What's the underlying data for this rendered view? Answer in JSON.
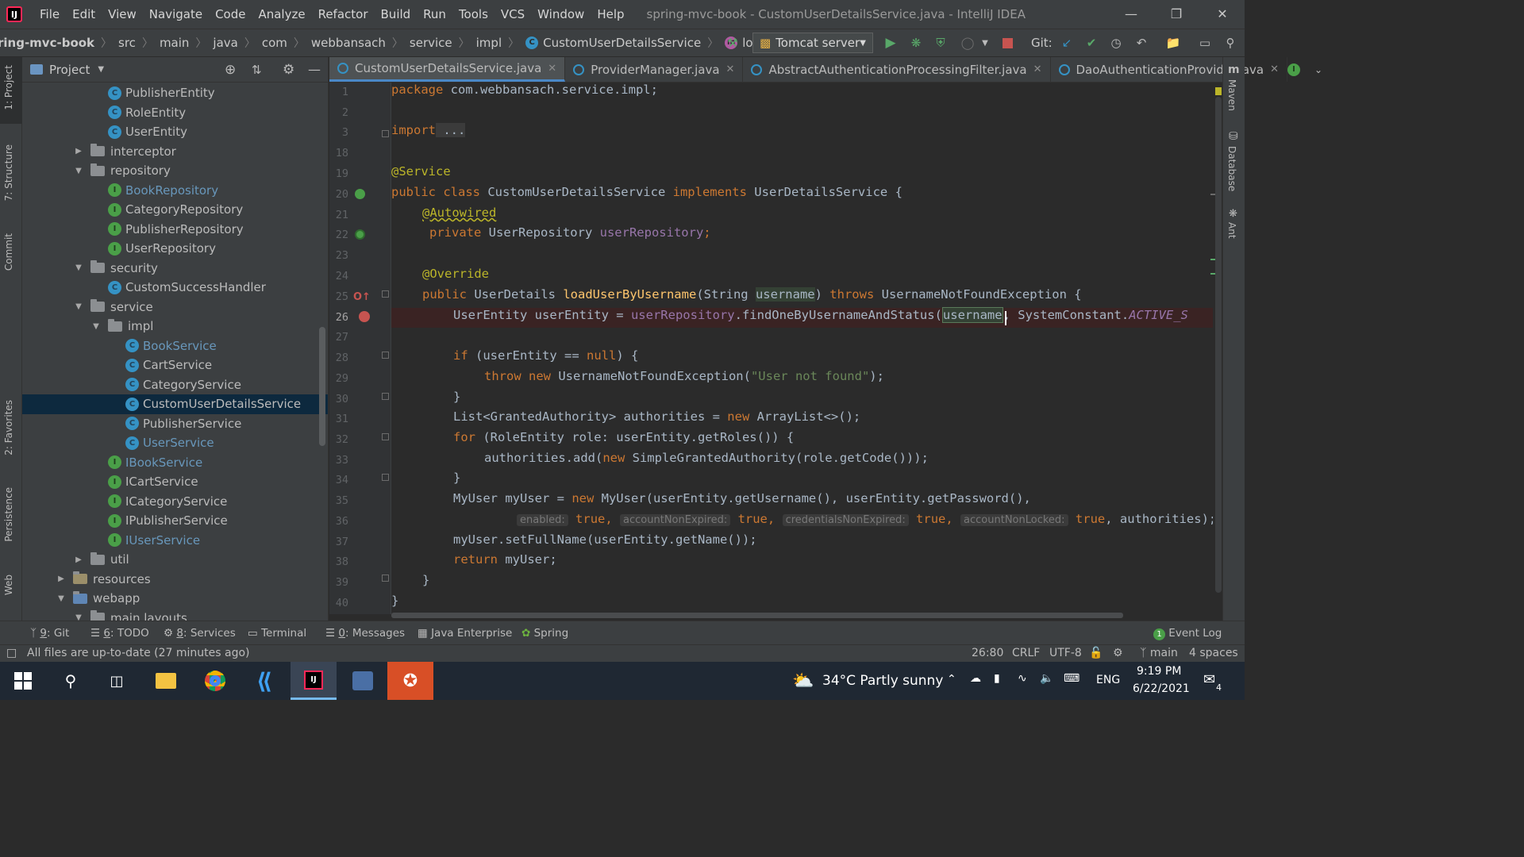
{
  "titlebar": {
    "menu": [
      "File",
      "Edit",
      "View",
      "Navigate",
      "Code",
      "Analyze",
      "Refactor",
      "Build",
      "Run",
      "Tools",
      "VCS",
      "Window",
      "Help"
    ],
    "window_title": "spring-mvc-book - CustomUserDetailsService.java - IntelliJ IDEA"
  },
  "navbar": {
    "crumbs": [
      "ring-mvc-book",
      "src",
      "main",
      "java",
      "com",
      "webbansach",
      "service",
      "impl",
      "CustomUserDetailsService",
      "loadUserByUsername"
    ],
    "run_config": "Tomcat server",
    "git_label": "Git:"
  },
  "left_strip": {
    "tabs": [
      "1: Project",
      "7: Structure",
      "Commit",
      "2: Favorites",
      "Persistence",
      "Web"
    ]
  },
  "right_strip": {
    "tabs": [
      "Maven",
      "Database",
      "Ant"
    ]
  },
  "project": {
    "title": "Project",
    "tree": [
      {
        "label": "PublisherEntity",
        "type": "class",
        "indent": 3,
        "color": "normal"
      },
      {
        "label": "RoleEntity",
        "type": "class",
        "indent": 3,
        "color": "normal"
      },
      {
        "label": "UserEntity",
        "type": "class",
        "indent": 3,
        "color": "normal"
      },
      {
        "label": "interceptor",
        "type": "folder",
        "indent": 2,
        "arrow": "right"
      },
      {
        "label": "repository",
        "type": "folder",
        "indent": 2,
        "arrow": "down"
      },
      {
        "label": "BookRepository",
        "type": "interface",
        "indent": 3,
        "color": "blue"
      },
      {
        "label": "CategoryRepository",
        "type": "interface",
        "indent": 3,
        "color": "normal"
      },
      {
        "label": "PublisherRepository",
        "type": "interface",
        "indent": 3,
        "color": "normal"
      },
      {
        "label": "UserRepository",
        "type": "interface",
        "indent": 3,
        "color": "normal"
      },
      {
        "label": "security",
        "type": "folder",
        "indent": 2,
        "arrow": "down"
      },
      {
        "label": "CustomSuccessHandler",
        "type": "class",
        "indent": 3,
        "color": "normal"
      },
      {
        "label": "service",
        "type": "folder",
        "indent": 2,
        "arrow": "down"
      },
      {
        "label": "impl",
        "type": "folder",
        "indent": 3,
        "arrow": "down"
      },
      {
        "label": "BookService",
        "type": "class",
        "indent": 4,
        "color": "blue"
      },
      {
        "label": "CartService",
        "type": "class",
        "indent": 4,
        "color": "normal"
      },
      {
        "label": "CategoryService",
        "type": "class",
        "indent": 4,
        "color": "normal"
      },
      {
        "label": "CustomUserDetailsService",
        "type": "class",
        "indent": 4,
        "color": "normal",
        "selected": true
      },
      {
        "label": "PublisherService",
        "type": "class",
        "indent": 4,
        "color": "normal"
      },
      {
        "label": "UserService",
        "type": "class",
        "indent": 4,
        "color": "blue"
      },
      {
        "label": "IBookService",
        "type": "interface",
        "indent": 3,
        "color": "blue"
      },
      {
        "label": "ICartService",
        "type": "interface",
        "indent": 3,
        "color": "normal"
      },
      {
        "label": "ICategoryService",
        "type": "interface",
        "indent": 3,
        "color": "normal"
      },
      {
        "label": "IPublisherService",
        "type": "interface",
        "indent": 3,
        "color": "normal"
      },
      {
        "label": "IUserService",
        "type": "interface",
        "indent": 3,
        "color": "blue"
      },
      {
        "label": "util",
        "type": "folder",
        "indent": 2,
        "arrow": "right"
      },
      {
        "label": "resources",
        "type": "folder-res",
        "indent": 1,
        "arrow": "right"
      },
      {
        "label": "webapp",
        "type": "folder-web",
        "indent": 1,
        "arrow": "down"
      },
      {
        "label": "main.layouts",
        "type": "folder",
        "indent": 2,
        "arrow": "down"
      }
    ]
  },
  "editor": {
    "tabs": [
      {
        "label": "CustomUserDetailsService.java",
        "active": true
      },
      {
        "label": "ProviderManager.java",
        "active": false
      },
      {
        "label": "AbstractAuthenticationProcessingFilter.java",
        "active": false
      },
      {
        "label": "DaoAuthenticationProvider.java",
        "active": false
      }
    ],
    "line_numbers": [
      "1",
      "2",
      "3",
      "18",
      "19",
      "20",
      "21",
      "22",
      "23",
      "24",
      "25",
      "26",
      "27",
      "28",
      "29",
      "30",
      "31",
      "32",
      "33",
      "34",
      "35",
      "36",
      "37",
      "38",
      "39",
      "40"
    ],
    "current_line": "26",
    "lines": {
      "l1_kw": "package",
      "l1_rest": " com.webbansach.service.impl;",
      "l3_kw": "import",
      "l3_rest": " ...",
      "l19": "@Service",
      "l20_kw1": "public class",
      "l20_a": " CustomUserDetailsService ",
      "l20_kw2": "implements",
      "l20_b": " UserDetailsService {",
      "l21": "@Autowired",
      "l22_kw": "private",
      "l22_a": " UserRepository ",
      "l22_fld": "userRepository",
      "l22_b": ";",
      "l24": "@Override",
      "l25_kw": "public",
      "l25_a": " UserDetails ",
      "l25_fn": "loadUserByUsername",
      "l25_b": "(String ",
      "l25_param": "username",
      "l25_c": ") ",
      "l25_kw2": "throws",
      "l25_d": " UsernameNotFoundException {",
      "l26_a": "UserEntity userEntity = ",
      "l26_fld": "userRepository",
      "l26_b": ".findOneByUsernameAndStatus(",
      "l26_param": "username",
      "l26_c": ", SystemConstant.",
      "l26_const": "ACTIVE_S",
      "l28_kw": "if",
      "l28_a": " (userEntity == ",
      "l28_kw2": "null",
      "l28_b": ") {",
      "l29_kw": "throw new",
      "l29_a": " UsernameNotFoundException(",
      "l29_str": "\"User not found\"",
      "l29_b": ");",
      "l30": "}",
      "l31_a": "List<GrantedAuthority> authorities = ",
      "l31_kw": "new",
      "l31_b": " ArrayList<>();",
      "l32_kw": "for",
      "l32_a": " (RoleEntity role: userEntity.getRoles()) {",
      "l33_a": "authorities.add(",
      "l33_kw": "new",
      "l33_b": " SimpleGrantedAuthority(role.getCode()));",
      "l34": "}",
      "l35_a": "MyUser myUser = ",
      "l35_kw": "new",
      "l35_b": " MyUser(userEntity.getUsername(), userEntity.getPassword(),",
      "l36_h1": "enabled:",
      "l36_v1": "true",
      "l36_h2": "accountNonExpired:",
      "l36_v2": "true",
      "l36_h3": "credentialsNonExpired:",
      "l36_v3": "true",
      "l36_h4": "accountNonLocked:",
      "l36_v4": "true",
      "l36_end": ", authorities);",
      "l37": "myUser.setFullName(userEntity.getName());",
      "l38_kw": "return",
      "l38_a": " myUser;",
      "l39": "}",
      "l40": "}"
    }
  },
  "bottom_tools": {
    "git": {
      "num": "9",
      "label": ": Git"
    },
    "todo": {
      "num": "6",
      "label": ": TODO"
    },
    "services": {
      "num": "8",
      "label": ": Services"
    },
    "terminal": "Terminal",
    "messages": {
      "num": "0",
      "label": ": Messages"
    },
    "java_enterprise": "Java Enterprise",
    "spring": "Spring",
    "event_log": "Event Log"
  },
  "status": {
    "message": "All files are up-to-date (27 minutes ago)",
    "position": "26:80",
    "line_sep": "CRLF",
    "encoding": "UTF-8",
    "branch": "main",
    "indent": "4 spaces"
  },
  "taskbar": {
    "weather": "34°C  Partly sunny",
    "lang": "ENG",
    "time": "9:19 PM",
    "date": "6/22/2021",
    "notif_count": "4"
  },
  "colors": {
    "accent": "#4a88c7",
    "selection": "#0d293e",
    "error_line": "#3a2323",
    "keyword": "#cc7832",
    "annotation": "#bbb529",
    "field": "#9876aa",
    "string": "#6a8759",
    "method": "#ffc66d"
  }
}
